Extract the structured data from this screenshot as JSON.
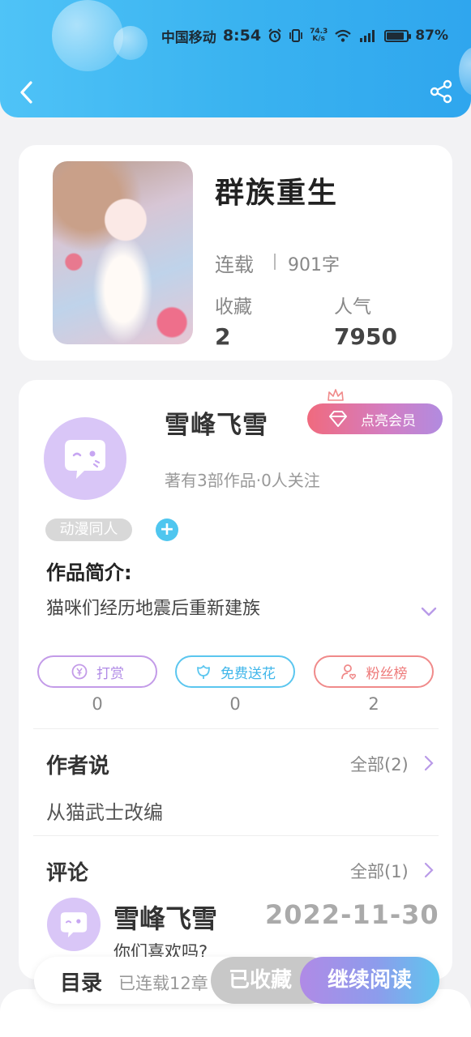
{
  "status_bar": {
    "carrier": "中国移动",
    "time": "8:54",
    "speed_value": "74.3",
    "speed_unit": "K/s",
    "battery": "87%",
    "battery_level": 0.87
  },
  "book": {
    "title": "群族重生",
    "status": "连载",
    "word_count": "901字",
    "favorites_label": "收藏",
    "favorites_value": "2",
    "popularity_label": "人气",
    "popularity_value": "7950"
  },
  "author": {
    "name": "雪峰飞雪",
    "vip_label": "点亮会员",
    "meta": "著有3部作品·0人关注",
    "tag": "动漫同人",
    "tag_add": "+"
  },
  "intro": {
    "label": "作品简介:",
    "text": "猫咪们经历地震后重新建族"
  },
  "actions": [
    {
      "label": "打赏",
      "count": "0",
      "color": "#c39be8"
    },
    {
      "label": "免费送花",
      "count": "0",
      "color": "#5bc6ef"
    },
    {
      "label": "粉丝榜",
      "count": "2",
      "color": "#f08a8a"
    }
  ],
  "author_says": {
    "title": "作者说",
    "all": "全部(2)",
    "text": "从猫武士改编"
  },
  "comments": {
    "title": "评论",
    "all": "全部(1)",
    "items": [
      {
        "name": "雪峰飞雪",
        "date": "2022-11-30",
        "text": "你们喜欢吗?"
      }
    ]
  },
  "bottom_bar": {
    "toc": "目录",
    "serial": "已连载12章",
    "favorited": "已收藏",
    "continue": "继续阅读"
  },
  "colors": {
    "header_blue": "#3ab3f0",
    "accent_purple": "#b08ae6",
    "accent_pink": "#f06a7e"
  }
}
